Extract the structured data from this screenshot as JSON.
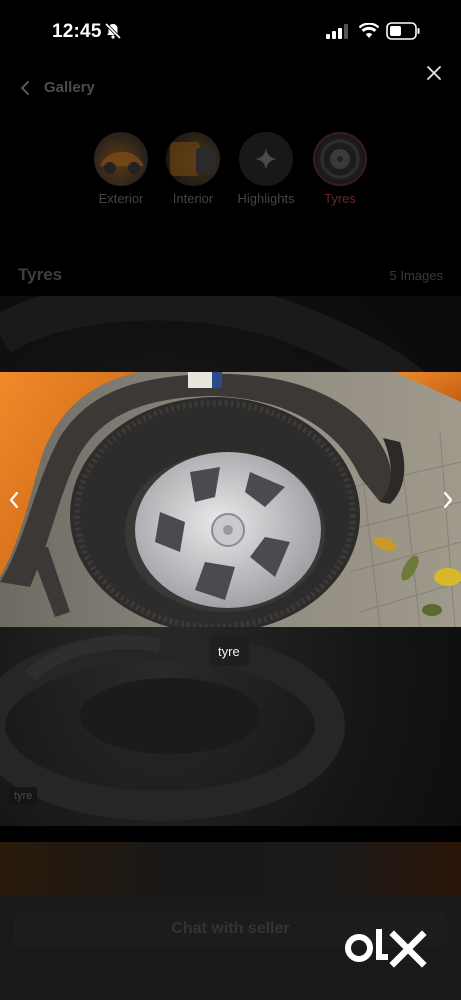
{
  "status_bar": {
    "time": "12:45"
  },
  "header": {
    "back_label": "Gallery"
  },
  "categories": [
    {
      "label": "Exterior",
      "icon": "car-exterior-thumbnail"
    },
    {
      "label": "Interior",
      "icon": "car-interior-thumbnail"
    },
    {
      "label": "Highlights",
      "icon": "sparkle-icon"
    },
    {
      "label": "Tyres",
      "icon": "tyre-thumbnail",
      "active": true
    }
  ],
  "section": {
    "title": "Tyres",
    "count": "5 Images"
  },
  "background_tag": "tyre",
  "viewer": {
    "caption": "tyre"
  },
  "footer": {
    "chat_label": "Chat with seller"
  },
  "brand": {
    "logo_text": "OLX"
  },
  "colors": {
    "background": "#000000",
    "active_tab": "#6a2424",
    "car_orange": "#e07a22"
  }
}
